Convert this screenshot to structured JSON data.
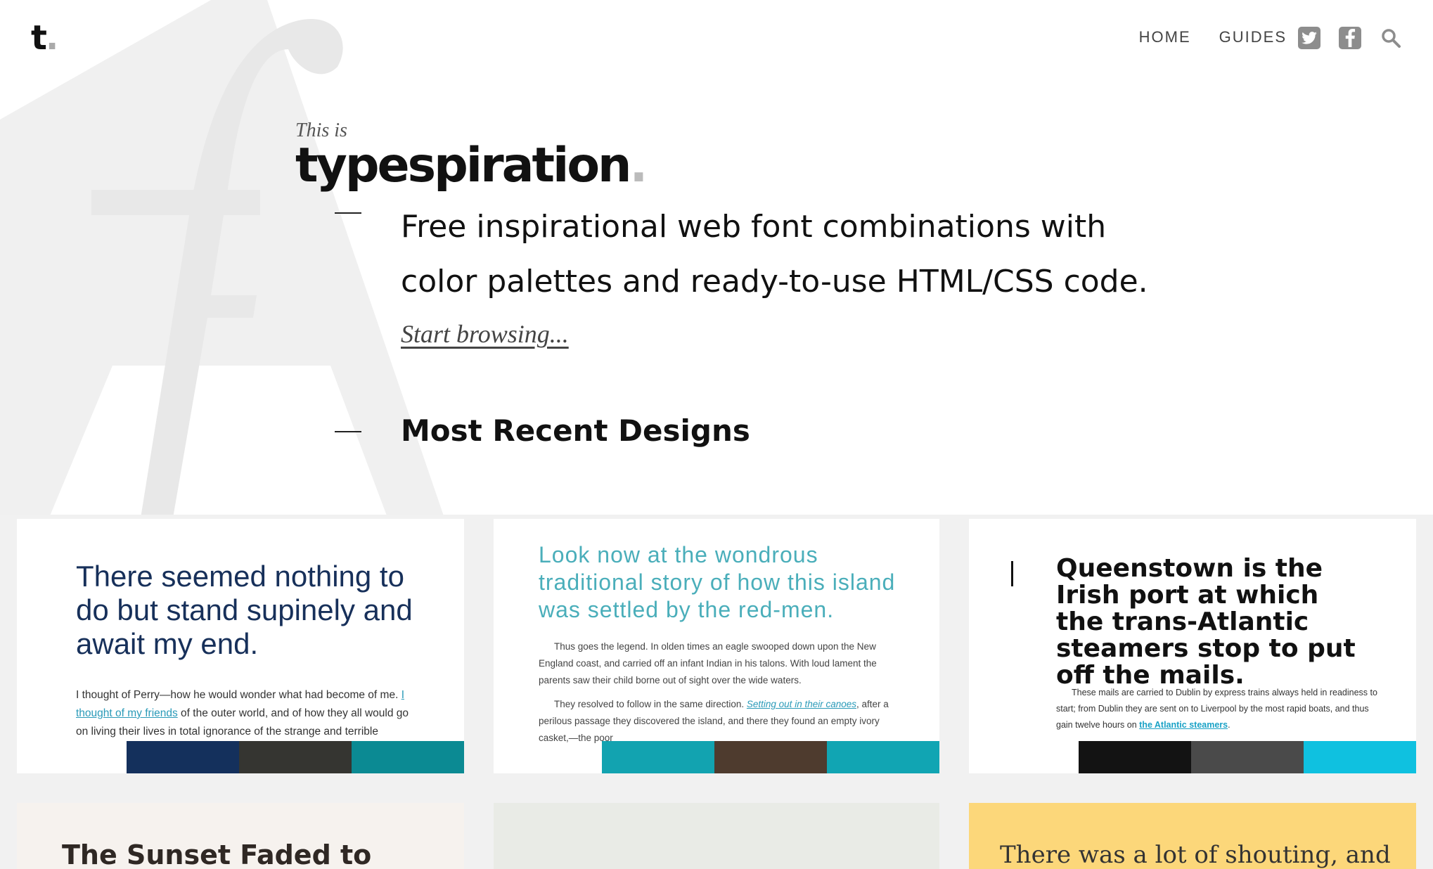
{
  "header": {
    "logo_letter": "t",
    "logo_dot": ".",
    "nav": [
      "HOME",
      "GUIDES"
    ],
    "icons": [
      "twitter-icon",
      "facebook-icon",
      "search-icon"
    ]
  },
  "hero": {
    "pre_title": "This is",
    "brand": "typespiration",
    "brand_dot": ".",
    "tagline": "Free inspirational web font combinations with color palettes and ready-to-use HTML/CSS code.",
    "cta": "Start browsing..."
  },
  "section": {
    "title": "Most Recent Designs"
  },
  "cards": [
    {
      "title": "There seemed nothing to do but stand supinely and await my end.",
      "body_before": "I thought of Perry—how he would wonder what had become of me. ",
      "body_link": "I thought of my friends",
      "body_after": " of the outer world, and of how they all would go on living their lives in total ignorance of the strange and terrible",
      "palette": [
        "#14305c",
        "#353531",
        "#0b8a93"
      ]
    },
    {
      "title": "Look now at the wondrous traditional story of how this island was settled by the red-men.",
      "body_p1": "Thus goes the legend. In olden times an eagle swooped down upon the New England coast, and carried off an infant Indian in his talons. With loud lament the parents saw their child borne out of sight over the wide waters.",
      "body_p2_before": "They resolved to follow in the same direction. ",
      "body_p2_link": "Setting out in their canoes",
      "body_p2_after": ", after a perilous passage they discovered the island, and there they found an empty ivory casket,—the poor",
      "palette": [
        "#12a3b0",
        "#4e3b2e",
        "#11a5b3"
      ]
    },
    {
      "title": "Queenstown is the Irish port at which the trans-Atlantic steamers stop to put off the mails.",
      "body_before": "These mails are carried to Dublin by express trains always held in readiness to start; from Dublin they are sent on to Liverpool by the most rapid boats, and thus gain twelve hours on ",
      "body_link": "the Atlantic steamers",
      "body_after": ".",
      "palette": [
        "#131313",
        "#4a4a4a",
        "#0fc1e0"
      ]
    },
    {
      "title": "The Sunset Faded to"
    },
    {
      "title": ""
    },
    {
      "title": "There was a lot of shouting, and one"
    }
  ]
}
